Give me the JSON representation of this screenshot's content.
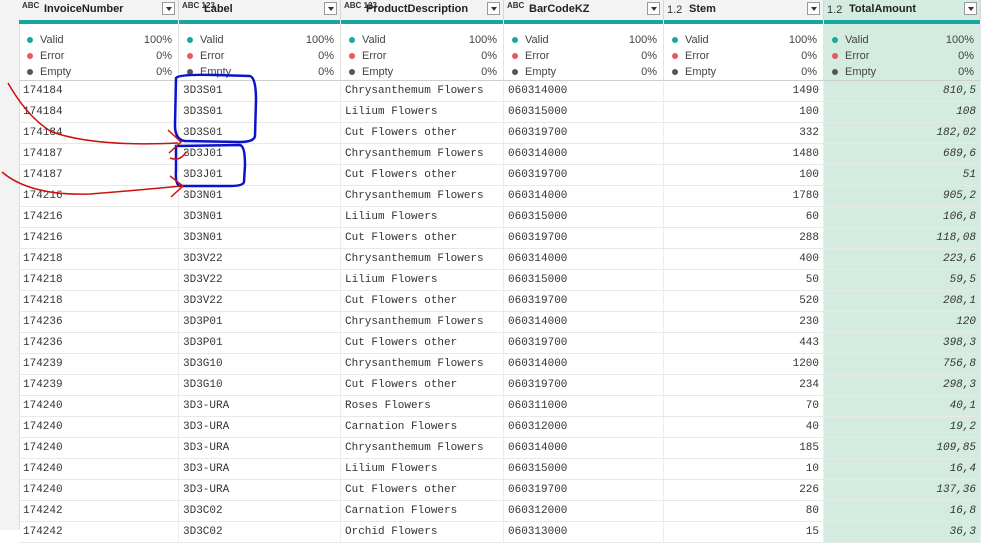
{
  "columns": [
    {
      "key": "invoice",
      "name": "InvoiceNumber",
      "type": "ABC",
      "align": "left",
      "valid": "100%",
      "error": "0%",
      "empty": "0%"
    },
    {
      "key": "label",
      "name": "Label",
      "type": "ABC 123",
      "align": "left",
      "valid": "100%",
      "error": "0%",
      "empty": "0%"
    },
    {
      "key": "desc",
      "name": "ProductDescription",
      "type": "ABC 123",
      "align": "left",
      "valid": "100%",
      "error": "0%",
      "empty": "0%"
    },
    {
      "key": "barcode",
      "name": "BarCodeKZ",
      "type": "ABC",
      "align": "left",
      "valid": "100%",
      "error": "0%",
      "empty": "0%"
    },
    {
      "key": "stem",
      "name": "Stem",
      "type": "1.2",
      "align": "right",
      "valid": "100%",
      "error": "0%",
      "empty": "0%"
    },
    {
      "key": "total",
      "name": "TotalAmount",
      "type": "1.2",
      "align": "right",
      "valid": "100%",
      "error": "0%",
      "empty": "0%",
      "selected": true
    }
  ],
  "quality_labels": {
    "valid": "Valid",
    "error": "Error",
    "empty": "Empty"
  },
  "colors": {
    "valid": "#1aa6a0",
    "error": "#e85a5a",
    "empty": "#555555",
    "accent": "#1aa6a0",
    "selected_column": "#d4ecdf",
    "annotation_red": "#cc1111",
    "annotation_blue": "#0b13c8"
  },
  "rows": [
    {
      "invoice": "174184",
      "label": "3D3S01",
      "desc": "Chrysanthemum Flowers",
      "barcode": "060314000",
      "stem": "1490",
      "total": "810,5"
    },
    {
      "invoice": "174184",
      "label": "3D3S01",
      "desc": "Lilium Flowers",
      "barcode": "060315000",
      "stem": "100",
      "total": "108"
    },
    {
      "invoice": "174184",
      "label": "3D3S01",
      "desc": "Cut Flowers other",
      "barcode": "060319700",
      "stem": "332",
      "total": "182,02"
    },
    {
      "invoice": "174187",
      "label": "3D3J01",
      "desc": "Chrysanthemum Flowers",
      "barcode": "060314000",
      "stem": "1480",
      "total": "689,6"
    },
    {
      "invoice": "174187",
      "label": "3D3J01",
      "desc": "Cut Flowers other",
      "barcode": "060319700",
      "stem": "100",
      "total": "51"
    },
    {
      "invoice": "174216",
      "label": "3D3N01",
      "desc": "Chrysanthemum Flowers",
      "barcode": "060314000",
      "stem": "1780",
      "total": "905,2"
    },
    {
      "invoice": "174216",
      "label": "3D3N01",
      "desc": "Lilium Flowers",
      "barcode": "060315000",
      "stem": "60",
      "total": "106,8"
    },
    {
      "invoice": "174216",
      "label": "3D3N01",
      "desc": "Cut Flowers other",
      "barcode": "060319700",
      "stem": "288",
      "total": "118,08"
    },
    {
      "invoice": "174218",
      "label": "3D3V22",
      "desc": "Chrysanthemum Flowers",
      "barcode": "060314000",
      "stem": "400",
      "total": "223,6"
    },
    {
      "invoice": "174218",
      "label": "3D3V22",
      "desc": "Lilium Flowers",
      "barcode": "060315000",
      "stem": "50",
      "total": "59,5"
    },
    {
      "invoice": "174218",
      "label": "3D3V22",
      "desc": "Cut Flowers other",
      "barcode": "060319700",
      "stem": "520",
      "total": "208,1"
    },
    {
      "invoice": "174236",
      "label": "3D3P01",
      "desc": "Chrysanthemum Flowers",
      "barcode": "060314000",
      "stem": "230",
      "total": "120"
    },
    {
      "invoice": "174236",
      "label": "3D3P01",
      "desc": "Cut Flowers other",
      "barcode": "060319700",
      "stem": "443",
      "total": "398,3"
    },
    {
      "invoice": "174239",
      "label": "3D3G10",
      "desc": "Chrysanthemum Flowers",
      "barcode": "060314000",
      "stem": "1200",
      "total": "756,8"
    },
    {
      "invoice": "174239",
      "label": "3D3G10",
      "desc": "Cut Flowers other",
      "barcode": "060319700",
      "stem": "234",
      "total": "298,3"
    },
    {
      "invoice": "174240",
      "label": "3D3-URA",
      "desc": "Roses Flowers",
      "barcode": "060311000",
      "stem": "70",
      "total": "40,1"
    },
    {
      "invoice": "174240",
      "label": "3D3-URA",
      "desc": "Carnation Flowers",
      "barcode": "060312000",
      "stem": "40",
      "total": "19,2"
    },
    {
      "invoice": "174240",
      "label": "3D3-URA",
      "desc": "Chrysanthemum Flowers",
      "barcode": "060314000",
      "stem": "185",
      "total": "109,85"
    },
    {
      "invoice": "174240",
      "label": "3D3-URA",
      "desc": "Lilium Flowers",
      "barcode": "060315000",
      "stem": "10",
      "total": "16,4"
    },
    {
      "invoice": "174240",
      "label": "3D3-URA",
      "desc": "Cut Flowers other",
      "barcode": "060319700",
      "stem": "226",
      "total": "137,36"
    },
    {
      "invoice": "174242",
      "label": "3D3C02",
      "desc": "Carnation Flowers",
      "barcode": "060312000",
      "stem": "80",
      "total": "16,8"
    },
    {
      "invoice": "174242",
      "label": "3D3C02",
      "desc": "Orchid Flowers",
      "barcode": "060313000",
      "stem": "15",
      "total": "36,3"
    }
  ]
}
